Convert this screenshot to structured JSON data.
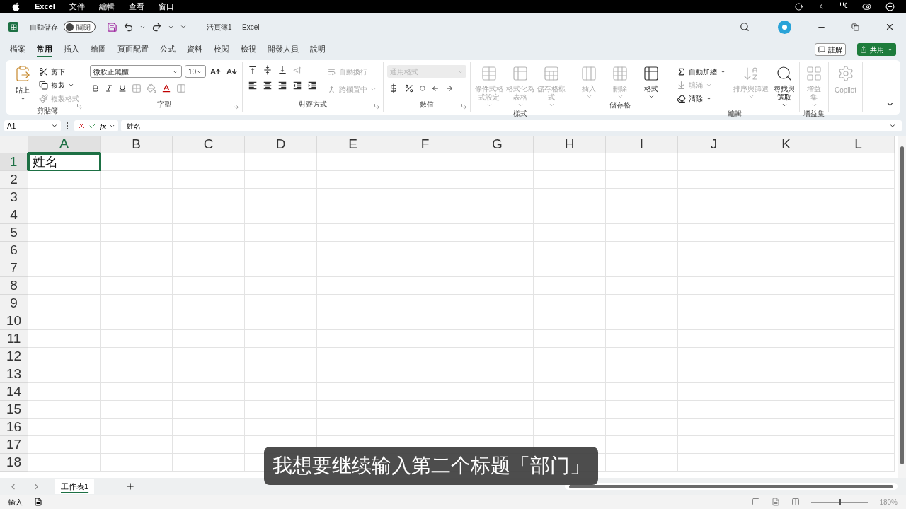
{
  "menubar": {
    "app": "Excel",
    "items": [
      "文件",
      "編輯",
      "查看",
      "窗口"
    ]
  },
  "titlebar": {
    "autosave_label": "自動儲存",
    "autosave": {
      "on": false,
      "label": "關閉"
    },
    "title": "活頁簿1  -  Excel"
  },
  "tabs": [
    {
      "label": "檔案",
      "selected": false
    },
    {
      "label": "常用",
      "selected": true
    },
    {
      "label": "插入",
      "selected": false
    },
    {
      "label": "繪圖",
      "selected": false
    },
    {
      "label": "頁面配置",
      "selected": false
    },
    {
      "label": "公式",
      "selected": false
    },
    {
      "label": "資料",
      "selected": false
    },
    {
      "label": "校閱",
      "selected": false
    },
    {
      "label": "檢視",
      "selected": false
    },
    {
      "label": "開發人員",
      "selected": false
    },
    {
      "label": "說明",
      "selected": false
    }
  ],
  "comments_button": "註解",
  "share_button": "共用",
  "ribbon": {
    "groups": [
      {
        "kind": "clipboard",
        "label": "剪貼簿",
        "launcher": true,
        "items": [
          {
            "label": "貼上",
            "disabled": false
          },
          {
            "label": "剪下",
            "disabled": false
          },
          {
            "label": "複製",
            "disabled": false
          },
          {
            "label": "複製格式",
            "disabled": true
          }
        ]
      },
      {
        "kind": "font",
        "label": "字型",
        "launcher": true,
        "font_name": "微軟正黑體",
        "font_size": "10"
      },
      {
        "kind": "alignment",
        "label": "對齊方式",
        "launcher": true,
        "items": [
          {
            "label": "自動換行",
            "disabled": true
          },
          {
            "label": "跨欄置中",
            "disabled": true
          }
        ]
      },
      {
        "kind": "number",
        "label": "數值",
        "launcher": true,
        "format": {
          "placeholder": "通用格式",
          "disabled": true
        }
      },
      {
        "kind": "large",
        "label": "樣式",
        "launcher": false,
        "items": [
          {
            "label": "條件式格式設定",
            "disabled": true
          },
          {
            "label": "格式化為表格",
            "disabled": true
          },
          {
            "label": "儲存格樣式",
            "disabled": true
          }
        ]
      },
      {
        "kind": "large",
        "label": "儲存格",
        "launcher": false,
        "items": [
          {
            "label": "插入",
            "disabled": true
          },
          {
            "label": "刪除",
            "disabled": true
          },
          {
            "label": "格式",
            "disabled": false
          }
        ]
      },
      {
        "kind": "editing",
        "label": "編輯",
        "launcher": false,
        "items": [
          {
            "label": "自動加總",
            "disabled": false
          },
          {
            "label": "填滿",
            "disabled": true
          },
          {
            "label": "清除",
            "disabled": false
          },
          {
            "label": "排序與篩選",
            "disabled": true
          },
          {
            "label": "尋找與選取",
            "disabled": false
          }
        ]
      },
      {
        "kind": "large",
        "label": "增益集",
        "launcher": false,
        "items": [
          {
            "label": "增益集",
            "disabled": true
          }
        ]
      }
    ],
    "copilot": {
      "label": "Copilot",
      "disabled": true
    }
  },
  "formula_bar": {
    "name_box": "A1",
    "function_label": "fx",
    "value": "姓名"
  },
  "sheet": {
    "columns": [
      {
        "label": "A",
        "selected": true
      },
      {
        "label": "B",
        "selected": false
      },
      {
        "label": "C",
        "selected": false
      },
      {
        "label": "D",
        "selected": false
      },
      {
        "label": "E",
        "selected": false
      },
      {
        "label": "F",
        "selected": false
      },
      {
        "label": "G",
        "selected": false
      },
      {
        "label": "H",
        "selected": false
      },
      {
        "label": "I",
        "selected": false
      },
      {
        "label": "J",
        "selected": false
      },
      {
        "label": "K",
        "selected": false
      },
      {
        "label": "L",
        "selected": false
      }
    ],
    "rows": [
      {
        "label": "1",
        "selected": true,
        "cells": [
          {
            "text": "姓名",
            "selected": true
          }
        ]
      },
      {
        "label": "2",
        "selected": false
      },
      {
        "label": "3",
        "selected": false
      },
      {
        "label": "4",
        "selected": false
      },
      {
        "label": "5",
        "selected": false
      },
      {
        "label": "6",
        "selected": false
      },
      {
        "label": "7",
        "selected": false
      },
      {
        "label": "8",
        "selected": false
      },
      {
        "label": "9",
        "selected": false
      },
      {
        "label": "10",
        "selected": false
      },
      {
        "label": "11",
        "selected": false
      },
      {
        "label": "12",
        "selected": false
      },
      {
        "label": "13",
        "selected": false
      },
      {
        "label": "14",
        "selected": false
      },
      {
        "label": "15",
        "selected": false
      },
      {
        "label": "16",
        "selected": false
      },
      {
        "label": "17",
        "selected": false
      },
      {
        "label": "18",
        "selected": false
      }
    ]
  },
  "sheet_tabs": [
    {
      "label": "工作表1",
      "selected": true
    }
  ],
  "status_bar": {
    "mode": "輸入",
    "zoom": {
      "level": 0.5,
      "label": "180%"
    }
  },
  "caption": "我想要继续输入第二个标题「部门」"
}
